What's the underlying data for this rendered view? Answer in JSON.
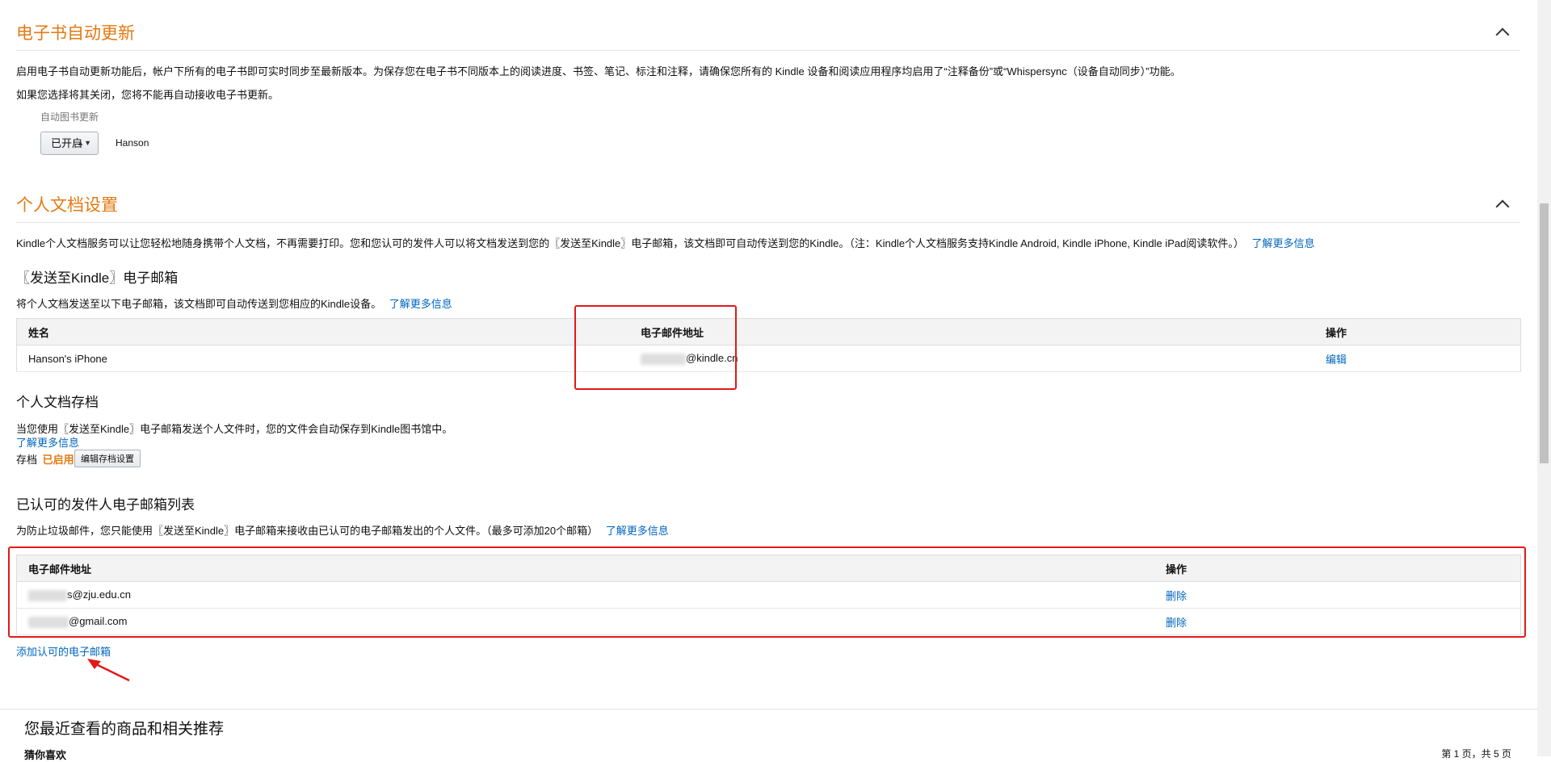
{
  "ebook": {
    "title": "电子书自动更新",
    "desc1": "启用电子书自动更新功能后，帐户下所有的电子书即可实时同步至最新版本。为保存您在电子书不同版本上的阅读进度、书签、笔记、标注和注释，请确保您所有的 Kindle 设备和阅读应用程序均启用了“注释备份”或“Whispersync（设备自动同步）”功能。",
    "desc2": "如果您选择将其关闭，您将不能再自动接收电子书更新。",
    "setting_label": "自动图书更新",
    "dropdown_value": "已开启",
    "dropdown_arrows": "▲▼",
    "owner": "Hanson"
  },
  "personal": {
    "title": "个人文档设置",
    "desc": "Kindle个人文档服务可以让您轻松地随身携带个人文档，不再需要打印。您和您认可的发件人可以将文档发送到您的〖发送至Kindle〗电子邮箱，该文档即可自动传送到您的Kindle。（注：Kindle个人文档服务支持Kindle Android, Kindle iPhone, Kindle iPad阅读软件。）",
    "learn_more": "了解更多信息"
  },
  "send_to_kindle": {
    "heading": "〖发送至Kindle〗电子邮箱",
    "desc": "将个人文档发送至以下电子邮箱，该文档即可自动传送到您相应的Kindle设备。",
    "learn_more": "了解更多信息",
    "columns": [
      "姓名",
      "电子邮件地址",
      "操作"
    ],
    "rows": [
      {
        "name": "Hanson's iPhone",
        "email": "@kindle.cn",
        "action": "编辑"
      }
    ]
  },
  "archive": {
    "heading": "个人文档存档",
    "desc": "当您使用〖发送至Kindle〗电子邮箱发送个人文件时，您的文件会自动保存到Kindle图书馆中。",
    "learn_more": "了解更多信息",
    "status_label": "存档",
    "status_value": "已启用",
    "edit_button": "编辑存档设置"
  },
  "approved": {
    "heading": "已认可的发件人电子邮箱列表",
    "desc": "为防止垃圾邮件，您只能使用〖发送至Kindle〗电子邮箱来接收由已认可的电子邮箱发出的个人文件。（最多可添加20个邮箱）",
    "learn_more": "了解更多信息",
    "columns": [
      "电子邮件地址",
      "操作"
    ],
    "rows": [
      {
        "email": "s@zju.edu.cn",
        "action": "删除"
      },
      {
        "email": "@gmail.com",
        "action": "删除"
      }
    ],
    "add_link": "添加认可的电子邮箱"
  },
  "recommend": {
    "title": "您最近查看的商品和相关推荐",
    "subtitle": "猜你喜欢",
    "pager": "第 1 页，共 5 页"
  },
  "colors": {
    "section_title": "#e47911",
    "link": "#0066c0",
    "highlight_box": "#e31919",
    "enabled_status": "#e47911"
  }
}
